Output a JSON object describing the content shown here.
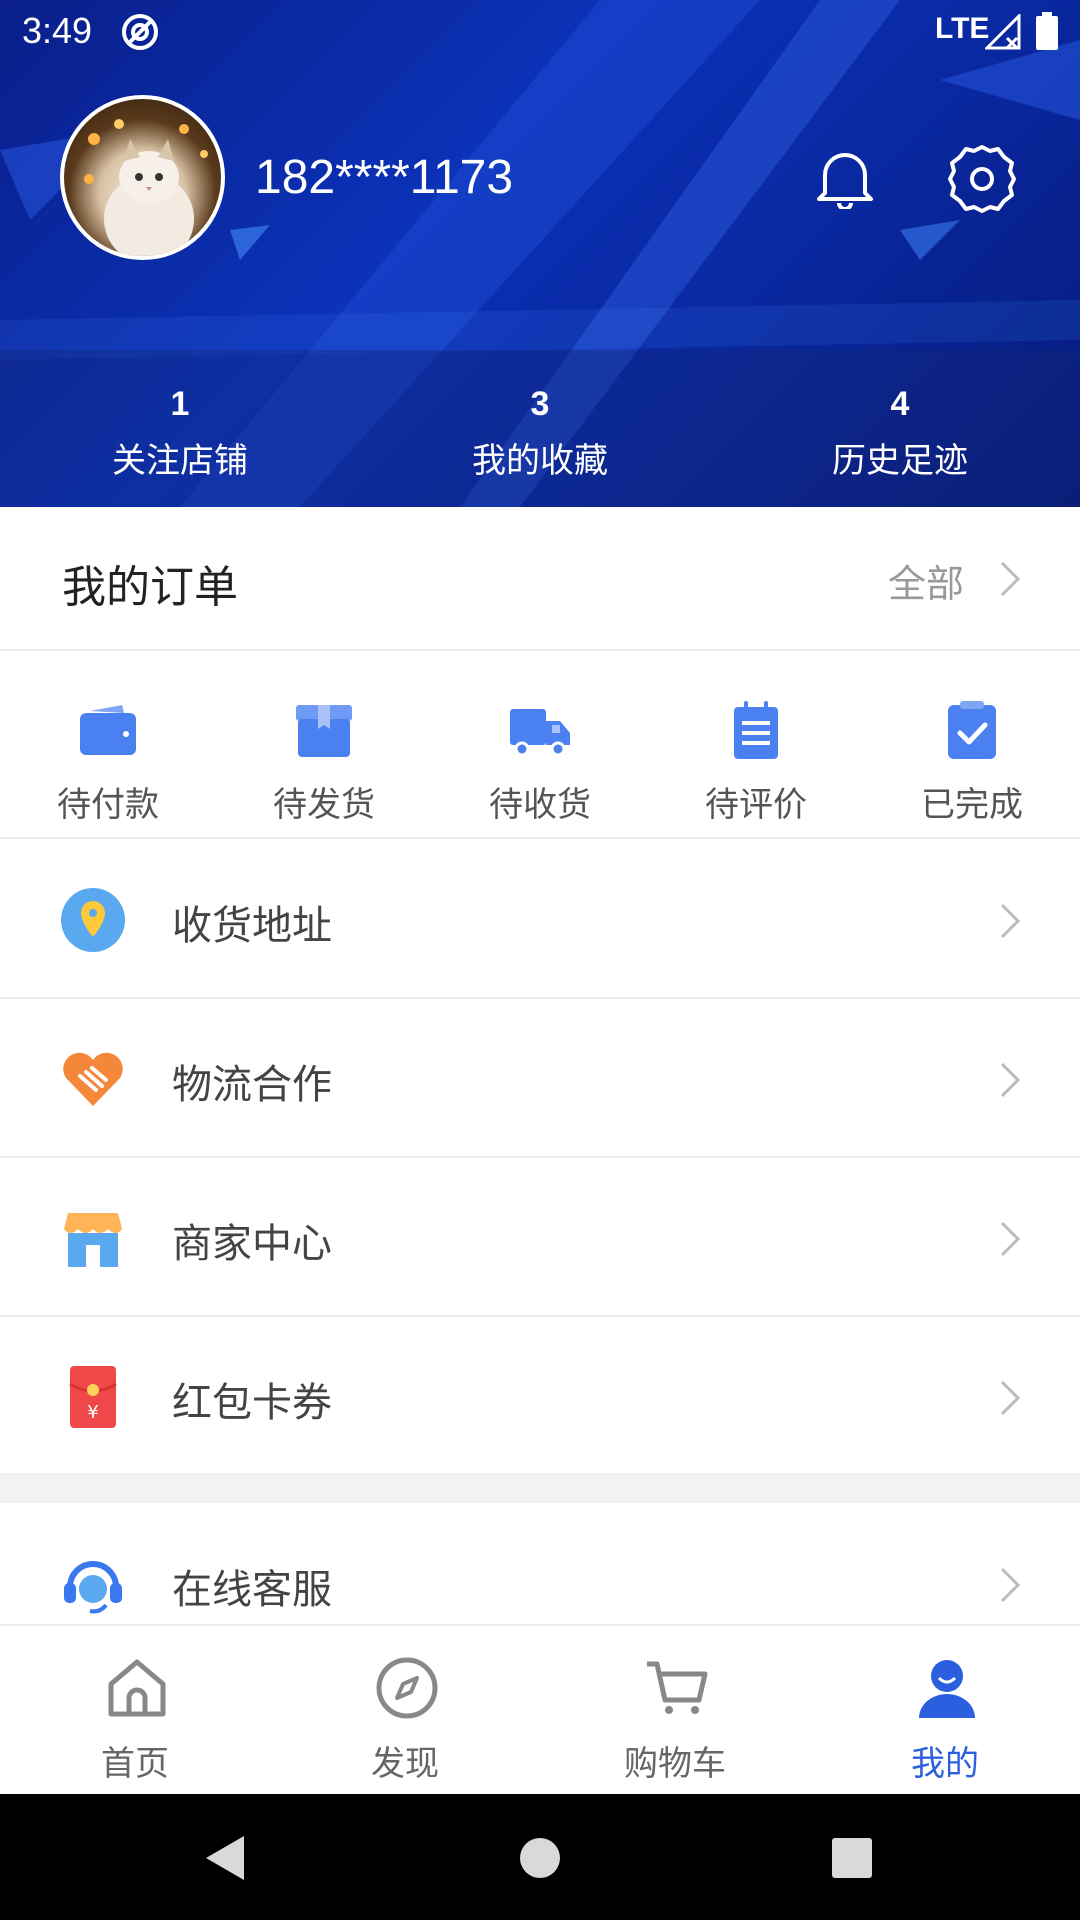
{
  "status_bar": {
    "time": "3:49",
    "network": "LTE"
  },
  "profile": {
    "username": "182****1173"
  },
  "stats": [
    {
      "count": "1",
      "label": "关注店铺"
    },
    {
      "count": "3",
      "label": "我的收藏"
    },
    {
      "count": "4",
      "label": "历史足迹"
    }
  ],
  "orders": {
    "title": "我的订单",
    "all_label": "全部",
    "items": [
      {
        "label": "待付款",
        "icon": "wallet-icon"
      },
      {
        "label": "待发货",
        "icon": "box-icon"
      },
      {
        "label": "待收货",
        "icon": "truck-icon"
      },
      {
        "label": "待评价",
        "icon": "clipboard-icon"
      },
      {
        "label": "已完成",
        "icon": "check-clipboard-icon"
      }
    ]
  },
  "menu": [
    {
      "label": "收货地址",
      "icon": "location-pin-icon"
    },
    {
      "label": "物流合作",
      "icon": "handshake-heart-icon"
    },
    {
      "label": "商家中心",
      "icon": "store-icon"
    },
    {
      "label": "红包卡券",
      "icon": "red-envelope-icon"
    },
    {
      "label": "在线客服",
      "icon": "headset-icon"
    }
  ],
  "bottom_nav": [
    {
      "label": "首页",
      "icon": "home-icon"
    },
    {
      "label": "发现",
      "icon": "compass-icon"
    },
    {
      "label": "购物车",
      "icon": "cart-icon"
    },
    {
      "label": "我的",
      "icon": "user-icon",
      "active": true
    }
  ],
  "colors": {
    "accent": "#2b5fe0",
    "header_blue": "#0b32b8",
    "order_icon": "#4a80f0"
  }
}
